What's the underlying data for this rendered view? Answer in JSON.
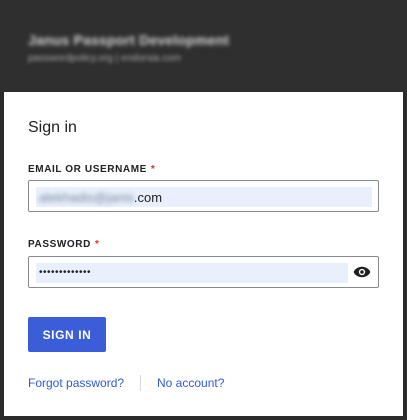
{
  "header": {
    "title": "Janus Passport Development",
    "subtitle": "passwordpolicy.org | endorsia.com"
  },
  "form": {
    "title": "Sign in",
    "email_label": "EMAIL OR USERNAME",
    "email_required_mark": "*",
    "email_value_obscured": "alekhadis@janis",
    "email_value_visible": ".com",
    "password_label": "PASSWORD",
    "password_required_mark": "*",
    "password_value": "•••••••••••••",
    "submit_label": "SIGN IN"
  },
  "links": {
    "forgot_password": "Forgot password?",
    "no_account": "No account?"
  },
  "colors": {
    "accent": "#3b5ed8",
    "link": "#2f5bd8",
    "required": "#d93025",
    "autofill": "#e8f0fe",
    "header": "#2f2f2f"
  },
  "icons": {
    "password_toggle": "eye-icon"
  }
}
